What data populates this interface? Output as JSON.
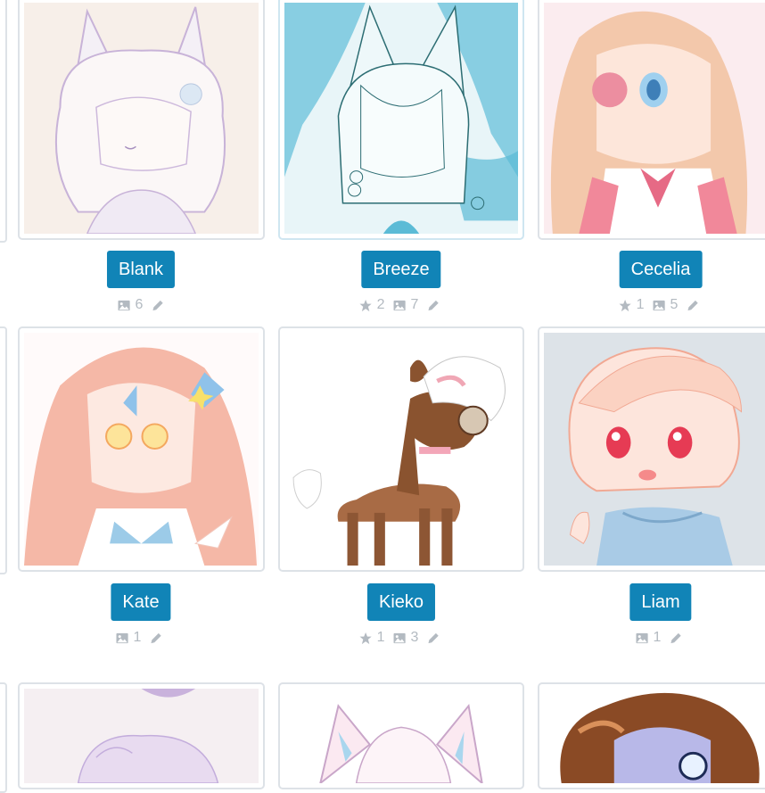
{
  "gallery": {
    "items": [
      {
        "name": "Blank",
        "stars": null,
        "images": "6",
        "image_theme": "cream-lilac"
      },
      {
        "name": "Breeze",
        "stars": "2",
        "images": "7",
        "image_theme": "teal-watercolor"
      },
      {
        "name": "Cecelia",
        "stars": "1",
        "images": "5",
        "image_theme": "pink-peach"
      },
      {
        "name": "Kate",
        "stars": null,
        "images": "1",
        "image_theme": "salmon-pink"
      },
      {
        "name": "Kieko",
        "stars": "1",
        "images": "3",
        "image_theme": "brown-deer"
      },
      {
        "name": "Liam",
        "stars": null,
        "images": "1",
        "image_theme": "grey-blue"
      }
    ],
    "icons": {
      "star": "star-icon",
      "image": "image-icon",
      "edit": "pencil-icon"
    },
    "colors": {
      "button": "#1184b7",
      "meta_text": "#b3bac1",
      "card_border": "#dde2e7"
    }
  }
}
